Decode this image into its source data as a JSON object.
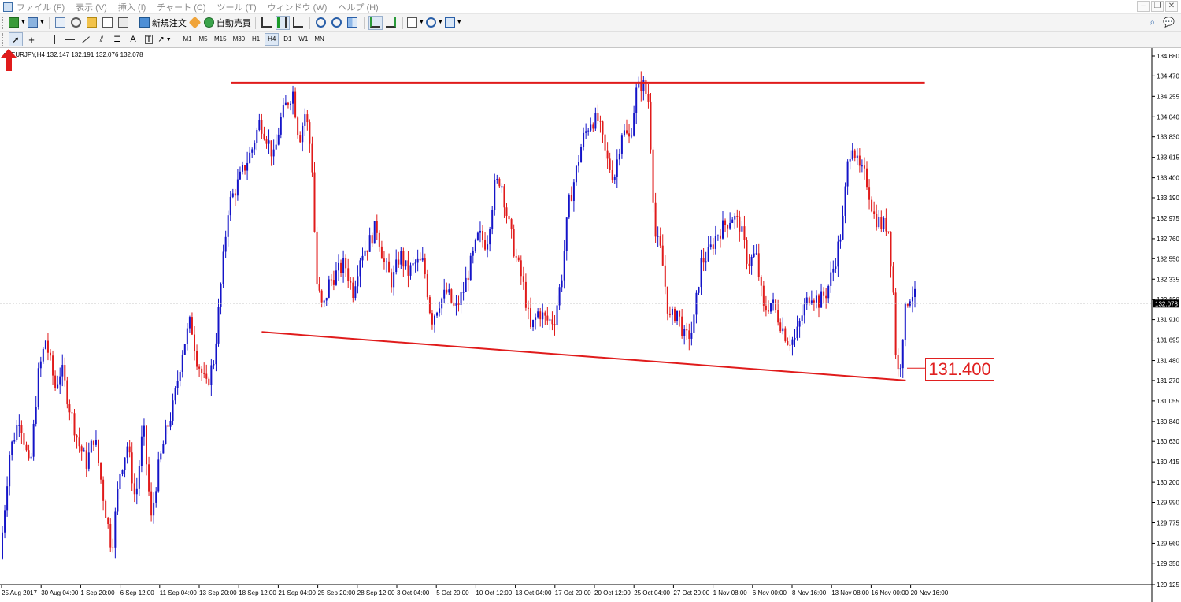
{
  "menu": {
    "items": [
      "ファイル (F)",
      "表示 (V)",
      "挿入 (I)",
      "チャート (C)",
      "ツール (T)",
      "ウィンドウ (W)",
      "ヘルプ (H)"
    ]
  },
  "toolbar": {
    "new_order_label": "新規注文",
    "auto_trading_label": "自動売買",
    "timeframes": [
      "M1",
      "M5",
      "M15",
      "M30",
      "H1",
      "H4",
      "D1",
      "W1",
      "MN"
    ],
    "active_timeframe": "H4"
  },
  "chart": {
    "header_text": "EURJPY,H4  132.147 132.191 132.076 132.078",
    "current_price_label": "132.078",
    "callout_text": "131.400",
    "colors": {
      "bull": "#1414c8",
      "bear": "#e01b1b",
      "trendline": "#e01b1b",
      "price_tag_bg": "#000000"
    }
  },
  "chart_data": {
    "type": "candlestick",
    "symbol": "EURJPY",
    "timeframe": "H4",
    "ylim": [
      129.125,
      134.68
    ],
    "y_ticks": [
      "134.680",
      "134.470",
      "134.255",
      "134.040",
      "133.830",
      "133.615",
      "133.400",
      "133.190",
      "132.975",
      "132.760",
      "132.550",
      "132.335",
      "132.120",
      "131.910",
      "131.695",
      "131.480",
      "131.270",
      "131.055",
      "130.840",
      "130.630",
      "130.415",
      "130.200",
      "129.990",
      "129.775",
      "129.560",
      "129.350",
      "129.125"
    ],
    "x_ticks": [
      "25 Aug 2017",
      "30 Aug 04:00",
      "1 Sep 20:00",
      "6 Sep 12:00",
      "11 Sep 04:00",
      "13 Sep 20:00",
      "18 Sep 12:00",
      "21 Sep 04:00",
      "25 Sep 20:00",
      "28 Sep 12:00",
      "3 Oct 04:00",
      "5 Oct 20:00",
      "10 Oct 12:00",
      "13 Oct 04:00",
      "17 Oct 20:00",
      "20 Oct 12:00",
      "25 Oct 04:00",
      "27 Oct 20:00",
      "1 Nov 08:00",
      "6 Nov 00:00",
      "8 Nov 16:00",
      "13 Nov 08:00",
      "16 Nov 00:00",
      "20 Nov 16:00"
    ],
    "close_path": [
      [
        0,
        129.4
      ],
      [
        12,
        130.5
      ],
      [
        25,
        130.9
      ],
      [
        38,
        130.3
      ],
      [
        48,
        131.3
      ],
      [
        58,
        131.7
      ],
      [
        70,
        131.2
      ],
      [
        78,
        131.4
      ],
      [
        88,
        131.0
      ],
      [
        100,
        130.6
      ],
      [
        110,
        130.4
      ],
      [
        120,
        130.7
      ],
      [
        132,
        130.0
      ],
      [
        142,
        129.5
      ],
      [
        152,
        130.3
      ],
      [
        162,
        130.6
      ],
      [
        172,
        130.0
      ],
      [
        182,
        130.8
      ],
      [
        192,
        129.8
      ],
      [
        200,
        130.3
      ],
      [
        210,
        130.7
      ],
      [
        220,
        131.0
      ],
      [
        232,
        131.6
      ],
      [
        242,
        131.9
      ],
      [
        250,
        131.5
      ],
      [
        262,
        131.2
      ],
      [
        272,
        131.5
      ],
      [
        282,
        132.4
      ],
      [
        290,
        133.1
      ],
      [
        300,
        133.3
      ],
      [
        310,
        133.5
      ],
      [
        320,
        133.7
      ],
      [
        330,
        134.0
      ],
      [
        340,
        133.8
      ],
      [
        348,
        133.6
      ],
      [
        356,
        134.0
      ],
      [
        365,
        134.2
      ],
      [
        372,
        134.3
      ],
      [
        380,
        133.8
      ],
      [
        388,
        134.1
      ],
      [
        396,
        133.6
      ],
      [
        402,
        132.3
      ],
      [
        410,
        132.0
      ],
      [
        418,
        132.3
      ],
      [
        428,
        132.4
      ],
      [
        438,
        132.5
      ],
      [
        448,
        132.2
      ],
      [
        458,
        132.6
      ],
      [
        468,
        132.7
      ],
      [
        478,
        132.9
      ],
      [
        488,
        132.5
      ],
      [
        498,
        132.3
      ],
      [
        508,
        132.6
      ],
      [
        518,
        132.4
      ],
      [
        528,
        132.5
      ],
      [
        538,
        132.5
      ],
      [
        548,
        131.9
      ],
      [
        558,
        132.1
      ],
      [
        568,
        132.2
      ],
      [
        578,
        132.0
      ],
      [
        588,
        132.2
      ],
      [
        598,
        132.5
      ],
      [
        608,
        132.8
      ],
      [
        618,
        132.7
      ],
      [
        628,
        133.3
      ],
      [
        636,
        133.4
      ],
      [
        644,
        133.0
      ],
      [
        654,
        132.6
      ],
      [
        664,
        132.3
      ],
      [
        674,
        131.8
      ],
      [
        684,
        132.0
      ],
      [
        694,
        131.9
      ],
      [
        704,
        131.9
      ],
      [
        714,
        132.4
      ],
      [
        722,
        133.1
      ],
      [
        730,
        133.4
      ],
      [
        740,
        133.8
      ],
      [
        750,
        134.0
      ],
      [
        760,
        134.0
      ],
      [
        770,
        133.6
      ],
      [
        780,
        133.4
      ],
      [
        790,
        133.9
      ],
      [
        800,
        133.8
      ],
      [
        808,
        134.3
      ],
      [
        816,
        134.4
      ],
      [
        824,
        134.2
      ],
      [
        832,
        132.8
      ],
      [
        840,
        132.6
      ],
      [
        850,
        131.9
      ],
      [
        860,
        132.0
      ],
      [
        870,
        131.7
      ],
      [
        880,
        131.8
      ],
      [
        890,
        132.5
      ],
      [
        900,
        132.6
      ],
      [
        910,
        132.8
      ],
      [
        920,
        132.9
      ],
      [
        930,
        133.0
      ],
      [
        940,
        132.9
      ],
      [
        950,
        132.5
      ],
      [
        960,
        132.6
      ],
      [
        970,
        132.0
      ],
      [
        980,
        132.1
      ],
      [
        990,
        131.9
      ],
      [
        1000,
        131.7
      ],
      [
        1010,
        131.7
      ],
      [
        1020,
        132.0
      ],
      [
        1030,
        132.2
      ],
      [
        1040,
        132.1
      ],
      [
        1050,
        132.2
      ],
      [
        1060,
        132.5
      ],
      [
        1070,
        132.9
      ],
      [
        1076,
        133.5
      ],
      [
        1082,
        133.8
      ],
      [
        1090,
        133.5
      ],
      [
        1100,
        133.4
      ],
      [
        1110,
        133.0
      ],
      [
        1120,
        132.9
      ],
      [
        1128,
        132.9
      ],
      [
        1134,
        132.3
      ],
      [
        1138,
        131.5
      ],
      [
        1142,
        131.3
      ],
      [
        1148,
        131.9
      ],
      [
        1152,
        132.1
      ],
      [
        1158,
        132.2
      ],
      [
        1165,
        132.1
      ]
    ],
    "resistance_line": {
      "from": [
        "18 Sep 12:00",
        134.4
      ],
      "to": [
        "20 Nov 16:00",
        134.4
      ]
    },
    "support_line": {
      "from": [
        "21 Sep 04:00",
        131.78
      ],
      "to": [
        "16 Nov 00:00",
        131.27
      ]
    },
    "annotation": {
      "label": "131.400",
      "marker": "up-arrow"
    }
  }
}
